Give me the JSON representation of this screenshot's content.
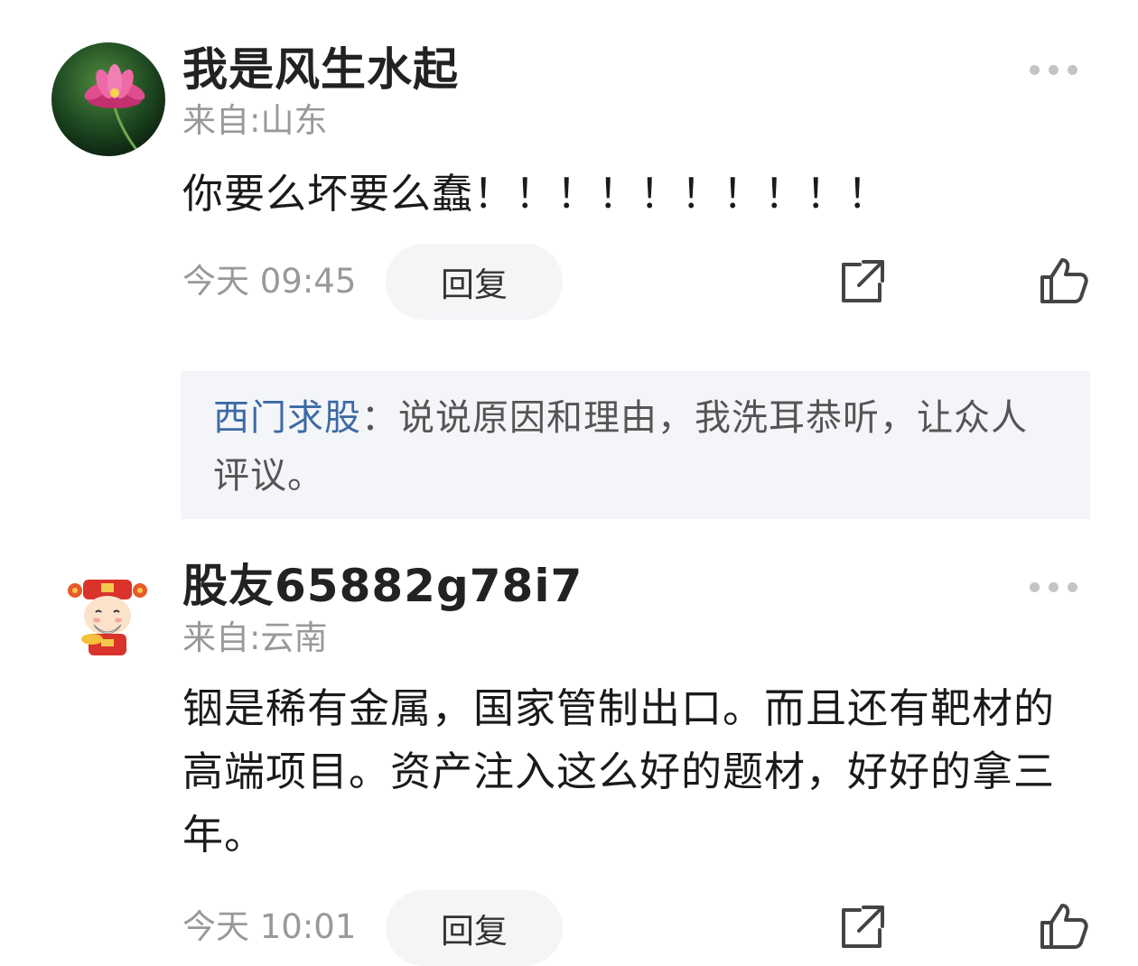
{
  "comments": [
    {
      "username": "我是风生水起",
      "location": "来自:山东",
      "content": "你要么坏要么蠢！！！！！！！！！！",
      "time": "今天 09:45",
      "reply_label": "回复",
      "avatar_icon": "lotus-avatar",
      "sub_reply": {
        "author": "西门求股",
        "separator": "：",
        "text": "说说原因和理由，我洗耳恭听，让众人评议。"
      }
    },
    {
      "username": "股友65882g78i7",
      "location": "来自:云南",
      "content": "铟是稀有金属，国家管制出口。而且还有靶材的高端项目。资产注入这么好的题材，好好的拿三年。",
      "time": "今天 10:01",
      "reply_label": "回复",
      "avatar_icon": "god-of-wealth-avatar"
    }
  ],
  "icons": {
    "more": "more-dots-icon",
    "share": "share-icon",
    "like": "thumbs-up-icon"
  },
  "colors": {
    "username": "#222222",
    "secondary_text": "#999999",
    "sub_author": "#3c6aa6",
    "sub_box_bg": "#f4f5f8",
    "reply_button_bg": "#f4f5f7"
  }
}
